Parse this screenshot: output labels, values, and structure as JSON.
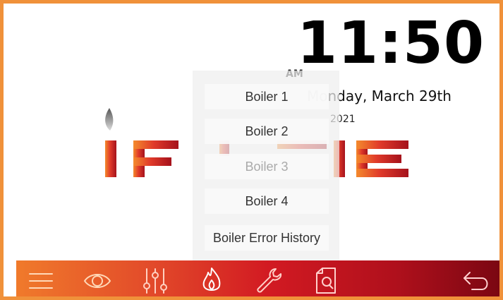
{
  "clock": {
    "time": "11:50",
    "ampm": "AM",
    "date": "Monday, March 29th",
    "year": "2021"
  },
  "logo": {
    "text": "IFCRE"
  },
  "menu": {
    "items": [
      {
        "label": "Boiler 1",
        "enabled": true
      },
      {
        "label": "Boiler 2",
        "enabled": true
      },
      {
        "label": "Boiler 3",
        "enabled": false
      },
      {
        "label": "Boiler 4",
        "enabled": true
      },
      {
        "label": "Boiler Error History",
        "enabled": true
      }
    ]
  },
  "toolbar": {
    "icons": [
      "menu-icon",
      "eye-icon",
      "sliders-icon",
      "flame-icon",
      "wrench-icon",
      "document-search-icon",
      "back-arrow-icon"
    ],
    "active": "flame-icon"
  },
  "colors": {
    "frame": "#f0913a",
    "toolbar_start": "#f07a2b",
    "toolbar_end": "#7a0712",
    "logo_orange": "#f07a2b",
    "logo_red": "#a5121c"
  }
}
